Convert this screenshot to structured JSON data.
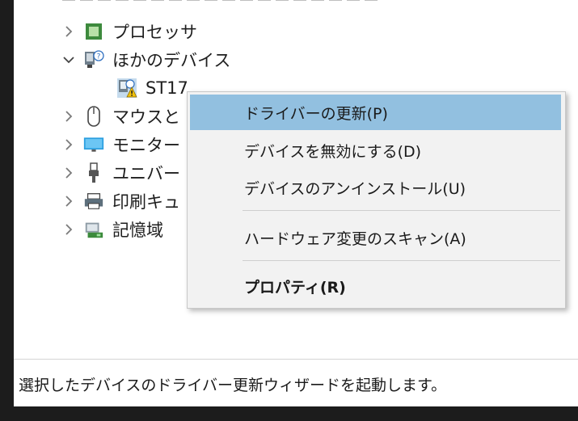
{
  "tree": {
    "items": [
      {
        "label": "プロセッサ",
        "expanded": false,
        "icon": "processor-icon"
      },
      {
        "label": "ほかのデバイス",
        "expanded": true,
        "icon": "unknown-device-icon"
      },
      {
        "label": "ST17",
        "icon": "warning-device-icon"
      },
      {
        "label": "マウスと",
        "expanded": false,
        "icon": "mouse-icon"
      },
      {
        "label": "モニター",
        "expanded": false,
        "icon": "monitor-icon"
      },
      {
        "label": "ユニバー",
        "expanded": false,
        "icon": "usb-icon"
      },
      {
        "label": "印刷キュ",
        "expanded": false,
        "icon": "printer-icon"
      },
      {
        "label": "記憶域",
        "expanded": false,
        "icon": "storage-icon"
      }
    ]
  },
  "context_menu": {
    "items": [
      {
        "label": "ドライバーの更新(P)",
        "highlighted": true
      },
      {
        "label": "デバイスを無効にする(D)"
      },
      {
        "label": "デバイスのアンインストール(U)"
      },
      {
        "label": "ハードウェア変更のスキャン(A)"
      },
      {
        "label": "プロパティ(R)",
        "bold": true
      }
    ]
  },
  "status": {
    "text": "選択したデバイスのドライバー更新ウィザードを起動します。"
  },
  "colors": {
    "highlight": "#92c0e0",
    "menu_bg": "#f2f2f2",
    "window_bg": "#ffffff",
    "frame": "#1c1c1c"
  }
}
